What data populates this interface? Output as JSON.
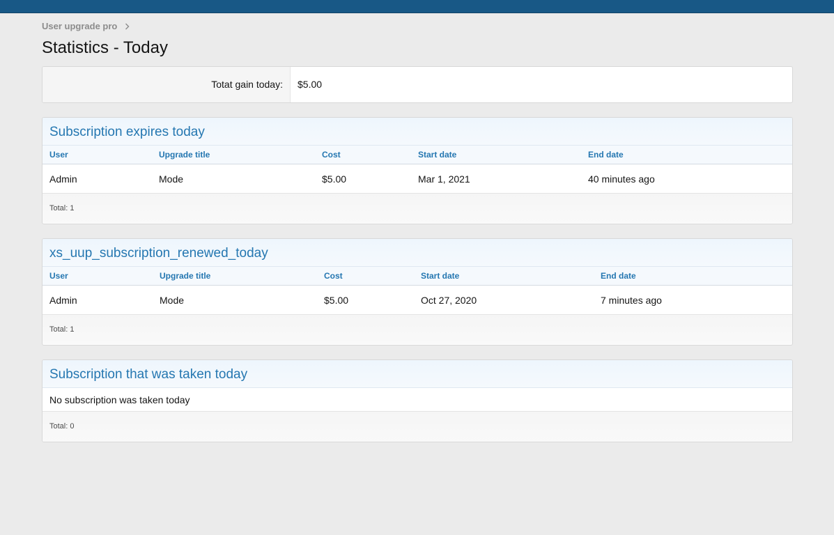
{
  "breadcrumb": {
    "label": "User upgrade pro"
  },
  "page": {
    "title": "Statistics - Today"
  },
  "gain": {
    "label": "Totat gain today:",
    "value": "$5.00"
  },
  "sections": [
    {
      "title": "Subscription expires today",
      "columns": [
        "User",
        "Upgrade title",
        "Cost",
        "Start date",
        "End date"
      ],
      "rows": [
        {
          "user": "Admin",
          "upgrade_title": "Mode",
          "cost": "$5.00",
          "start_date": "Mar 1, 2021",
          "end_date": "40 minutes ago"
        }
      ],
      "total": "Total: 1"
    },
    {
      "title": "xs_uup_subscription_renewed_today",
      "columns": [
        "User",
        "Upgrade title",
        "Cost",
        "Start date",
        "End date"
      ],
      "rows": [
        {
          "user": "Admin",
          "upgrade_title": "Mode",
          "cost": "$5.00",
          "start_date": "Oct 27, 2020",
          "end_date": "7 minutes ago"
        }
      ],
      "total": "Total: 1"
    },
    {
      "title": "Subscription that was taken today",
      "empty_message": "No subscription was taken today",
      "total": "Total: 0"
    }
  ],
  "colors": {
    "topbar": "#185886",
    "accent": "#2577b1",
    "background": "#ebebeb"
  }
}
